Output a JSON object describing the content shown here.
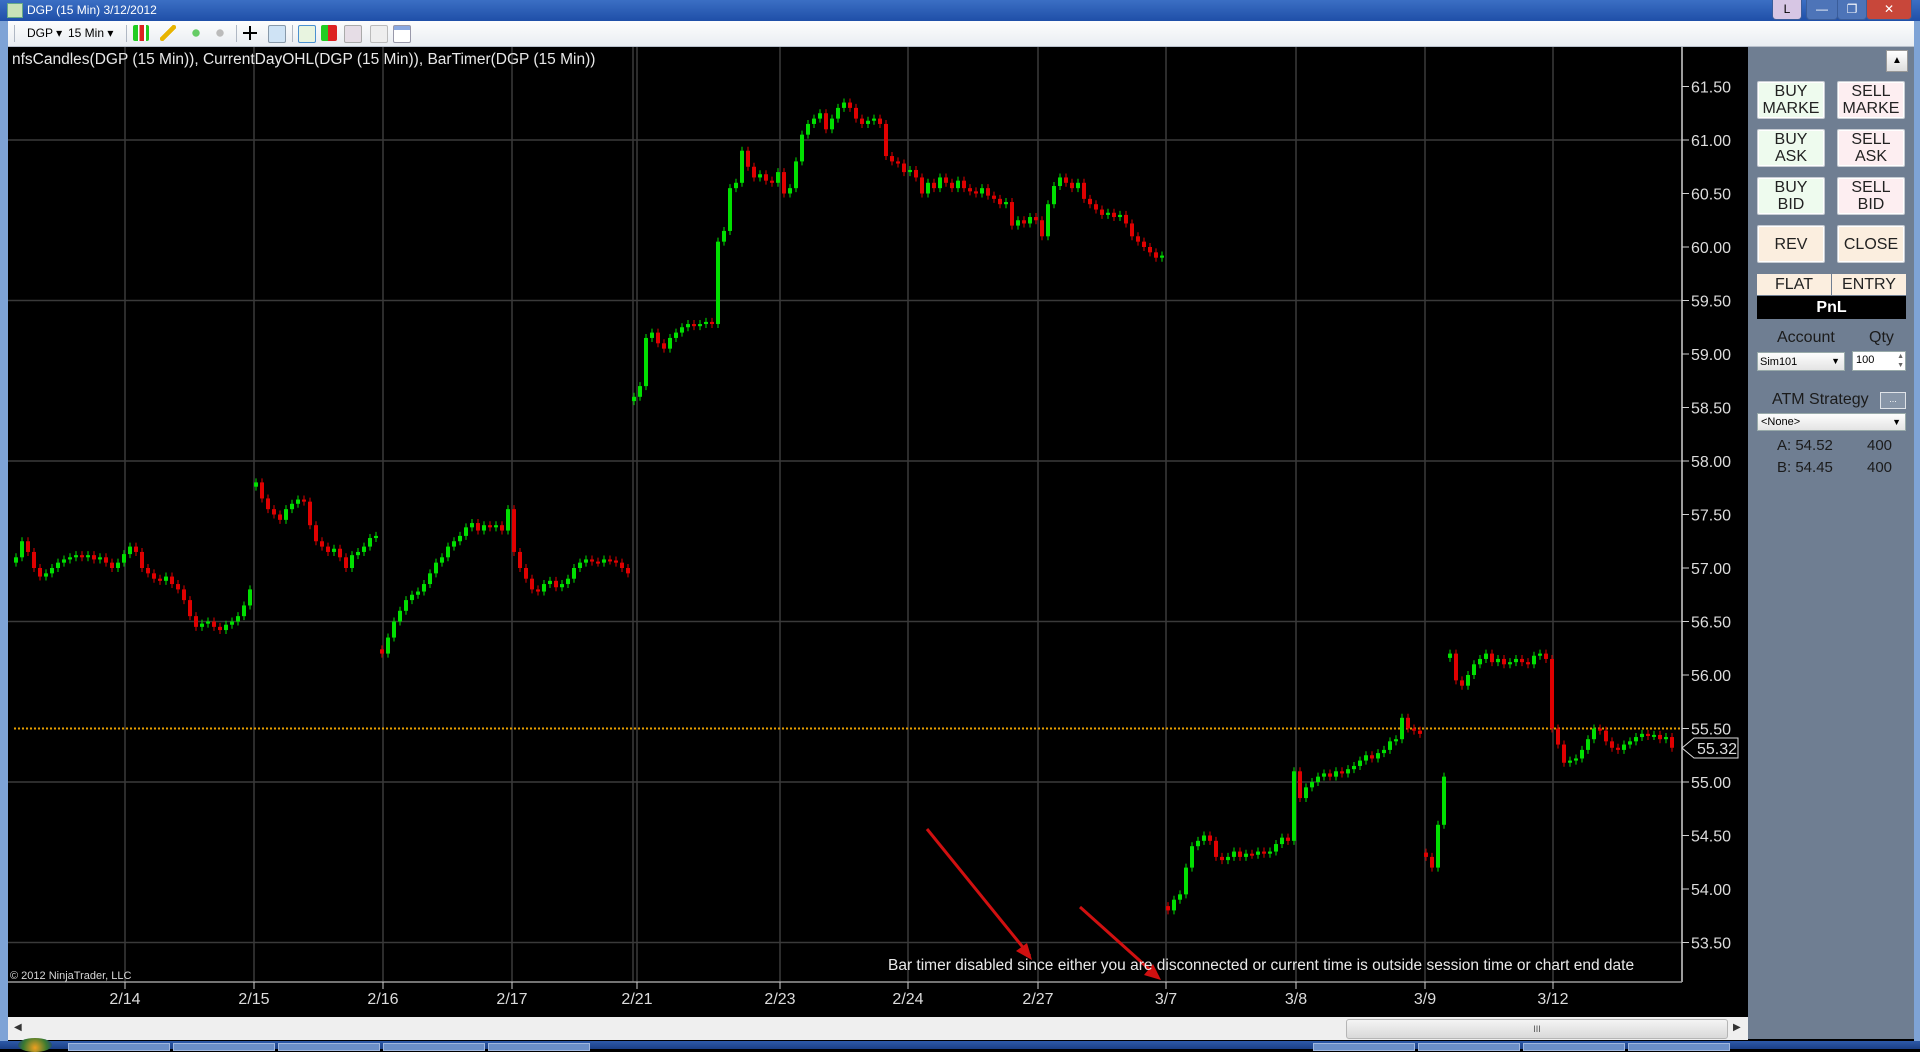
{
  "window": {
    "title": "DGP (15 Min)  3/12/2012",
    "link_button": "L",
    "minimize": "—",
    "maximize": "❐",
    "close": "✕"
  },
  "toolbar": {
    "instrument": "DGP ▾",
    "interval": "15 Min ▾",
    "icons": [
      "chart-style-icon",
      "draw-pencil-icon",
      "add-indicator-icon",
      "strategy-icon",
      "crosshair-icon",
      "zoom-icon",
      "data-box-icon",
      "bar-chart-icon",
      "properties-icon",
      "order-icon",
      "panel-icon"
    ]
  },
  "chart": {
    "indicator_title": "nfsCandles(DGP (15 Min)), CurrentDayOHL(DGP (15 Min)), BarTimer(DGP (15 Min))",
    "bar_timer_message": "Bar timer disabled since either you are disconnected or current time is outside session time or chart end date",
    "copyright": "© 2012 NinjaTrader, LLC",
    "colors": {
      "up": "#00e000",
      "down": "#e00000",
      "grid": "#3a3a3a",
      "open_line": "#e8a000",
      "annotation_arrow": "#d01010"
    }
  },
  "chart_data": {
    "type": "candlestick",
    "interval": "15 Min",
    "y_ticks": [
      "61.50",
      "61.00",
      "60.50",
      "60.00",
      "59.50",
      "59.00",
      "58.50",
      "58.00",
      "57.50",
      "57.00",
      "56.50",
      "56.00",
      "55.50",
      "55.00",
      "54.50",
      "54.00",
      "53.50"
    ],
    "ylim": [
      53.3,
      61.65
    ],
    "x_ticks": [
      "2/14",
      "2/15",
      "2/16",
      "2/17",
      "2/21",
      "2/23",
      "2/24",
      "2/27",
      "3/7",
      "3/8",
      "3/9",
      "3/12"
    ],
    "current_price": "55.32",
    "current_day_open": 55.5,
    "grid": true,
    "closes": [
      57.1,
      57.25,
      57.15,
      57.0,
      56.92,
      56.95,
      57.0,
      57.05,
      57.08,
      57.1,
      57.12,
      57.1,
      57.12,
      57.08,
      57.1,
      57.05,
      57.0,
      57.05,
      57.13,
      57.2,
      57.15,
      57.0,
      56.95,
      56.9,
      56.88,
      56.92,
      56.85,
      56.8,
      56.7,
      56.55,
      56.45,
      56.48,
      56.5,
      56.45,
      56.42,
      56.47,
      56.5,
      56.55,
      56.65,
      56.8,
      57.8,
      57.65,
      57.55,
      57.5,
      57.45,
      57.55,
      57.6,
      57.64,
      57.62,
      57.4,
      57.25,
      57.2,
      57.15,
      57.18,
      57.1,
      57.0,
      57.12,
      57.15,
      57.2,
      57.28,
      57.3,
      56.2,
      56.35,
      56.5,
      56.6,
      56.7,
      56.75,
      56.78,
      56.85,
      56.95,
      57.05,
      57.1,
      57.2,
      57.25,
      57.3,
      57.38,
      57.42,
      57.35,
      57.4,
      57.38,
      57.4,
      57.35,
      57.55,
      57.15,
      57.0,
      56.9,
      56.8,
      56.78,
      56.85,
      56.88,
      56.82,
      56.85,
      56.9,
      57.0,
      57.05,
      57.08,
      57.06,
      57.05,
      57.08,
      57.07,
      57.05,
      57.0,
      56.95,
      58.6,
      58.7,
      59.15,
      59.2,
      59.1,
      59.05,
      59.15,
      59.2,
      59.25,
      59.28,
      59.26,
      59.28,
      59.3,
      59.28,
      60.05,
      60.15,
      60.55,
      60.6,
      60.9,
      60.75,
      60.65,
      60.68,
      60.62,
      60.6,
      60.7,
      60.5,
      60.55,
      60.8,
      61.05,
      61.15,
      61.2,
      61.25,
      61.1,
      61.2,
      61.3,
      61.35,
      61.3,
      61.2,
      61.15,
      61.18,
      61.2,
      61.15,
      60.85,
      60.8,
      60.78,
      60.7,
      60.72,
      60.65,
      60.5,
      60.6,
      60.55,
      60.65,
      60.6,
      60.55,
      60.62,
      60.55,
      60.52,
      60.5,
      60.55,
      60.48,
      60.45,
      60.4,
      60.42,
      60.2,
      60.25,
      60.22,
      60.28,
      60.25,
      60.1,
      60.4,
      60.57,
      60.65,
      60.6,
      60.55,
      60.6,
      60.45,
      60.4,
      60.35,
      60.3,
      60.32,
      60.28,
      60.3,
      60.22,
      60.1,
      60.05,
      60.0,
      59.95,
      59.9,
      59.92,
      53.8,
      53.9,
      53.95,
      54.2,
      54.4,
      54.45,
      54.5,
      54.45,
      54.3,
      54.27,
      54.3,
      54.35,
      54.3,
      54.33,
      54.32,
      54.35,
      54.33,
      54.35,
      54.42,
      54.48,
      54.45,
      55.1,
      54.85,
      54.95,
      55.0,
      55.05,
      55.08,
      55.05,
      55.1,
      55.08,
      55.12,
      55.15,
      55.2,
      55.25,
      55.22,
      55.27,
      55.3,
      55.38,
      55.4,
      55.6,
      55.5,
      55.48,
      55.45,
      54.3,
      54.2,
      54.6,
      55.05,
      56.2,
      55.95,
      55.9,
      56.0,
      56.1,
      56.15,
      56.2,
      56.12,
      56.15,
      56.1,
      56.12,
      56.15,
      56.12,
      56.1,
      56.18,
      56.2,
      56.15,
      55.5,
      55.35,
      55.18,
      55.2,
      55.22,
      55.3,
      55.4,
      55.5,
      55.48,
      55.38,
      55.32,
      55.3,
      55.35,
      55.38,
      55.42,
      55.45,
      55.43,
      55.44,
      55.4,
      55.42,
      55.32
    ]
  },
  "panel": {
    "buttons": {
      "buy_market": "BUY\nMARKE",
      "sell_market": "SELL\nMARKE",
      "buy_ask": "BUY\nASK",
      "sell_ask": "SELL\nASK",
      "buy_bid": "BUY\nBID",
      "sell_bid": "SELL\nBID",
      "rev": "REV",
      "close": "CLOSE",
      "flat": "FLAT",
      "entry": "ENTRY"
    },
    "pnl_label": "PnL",
    "account_label": "Account",
    "account_value": "Sim101",
    "qty_label": "Qty",
    "qty_value": "100",
    "atm_label": "ATM Strategy",
    "atm_button": "...",
    "atm_value": "<None>",
    "ask": "A: 54.52",
    "ask_size": "400",
    "bid": "B: 54.45",
    "bid_size": "400"
  },
  "scrollbar": {
    "grip": "III"
  }
}
